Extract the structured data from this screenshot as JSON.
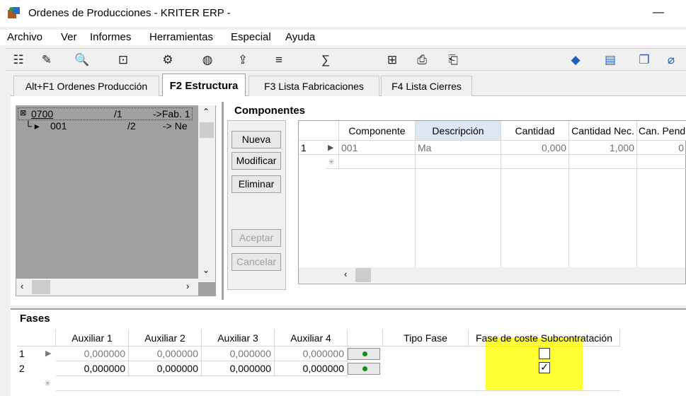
{
  "window": {
    "title": "Ordenes de Producciones - KRITER ERP -"
  },
  "menubar": {
    "items": [
      "Archivo",
      "Ver",
      "Informes",
      "Herramientas",
      "Especial",
      "Ayuda"
    ]
  },
  "tabs": [
    "Alt+F1 Ordenes Producción",
    "F2 Estructura",
    "F3 Lista Fabricaciones",
    "F4 Lista Cierres"
  ],
  "tree": {
    "rows": [
      {
        "code": "0700",
        "num": "/1",
        "dest": "->Fab. 1"
      },
      {
        "code": "001",
        "num": "/2",
        "dest": "-> Ne"
      }
    ]
  },
  "components": {
    "title": "Componentes",
    "buttons": {
      "new": "Nueva",
      "modify": "Modificar",
      "delete": "Eliminar",
      "accept": "Aceptar",
      "cancel": "Cancelar"
    },
    "columns": [
      "Componente",
      "Descripción",
      "Cantidad",
      "Cantidad Nec.",
      "Can. Pend"
    ],
    "rows": [
      {
        "index": "1",
        "component": "001",
        "description": "Ma",
        "qty": "0,000",
        "qty_nec": "1,000",
        "pend": "0"
      }
    ]
  },
  "fases": {
    "title": "Fases",
    "columns": [
      "Auxiliar 1",
      "Auxiliar 2",
      "Auxiliar 3",
      "Auxiliar 4",
      "",
      "Tipo Fase",
      "Fase de coste Subcontratación"
    ],
    "rows": [
      {
        "index": "1",
        "aux1": "0,000000",
        "aux2": "0,000000",
        "aux3": "0,000000",
        "aux4": "0,000000",
        "subcontratacion": false
      },
      {
        "index": "2",
        "aux1": "0,000000",
        "aux2": "0,000000",
        "aux3": "0,000000",
        "aux4": "0,000000",
        "subcontratacion": true
      }
    ]
  },
  "colors": {
    "highlight": "#ffff33",
    "tree_bg": "#a0a0a0"
  }
}
